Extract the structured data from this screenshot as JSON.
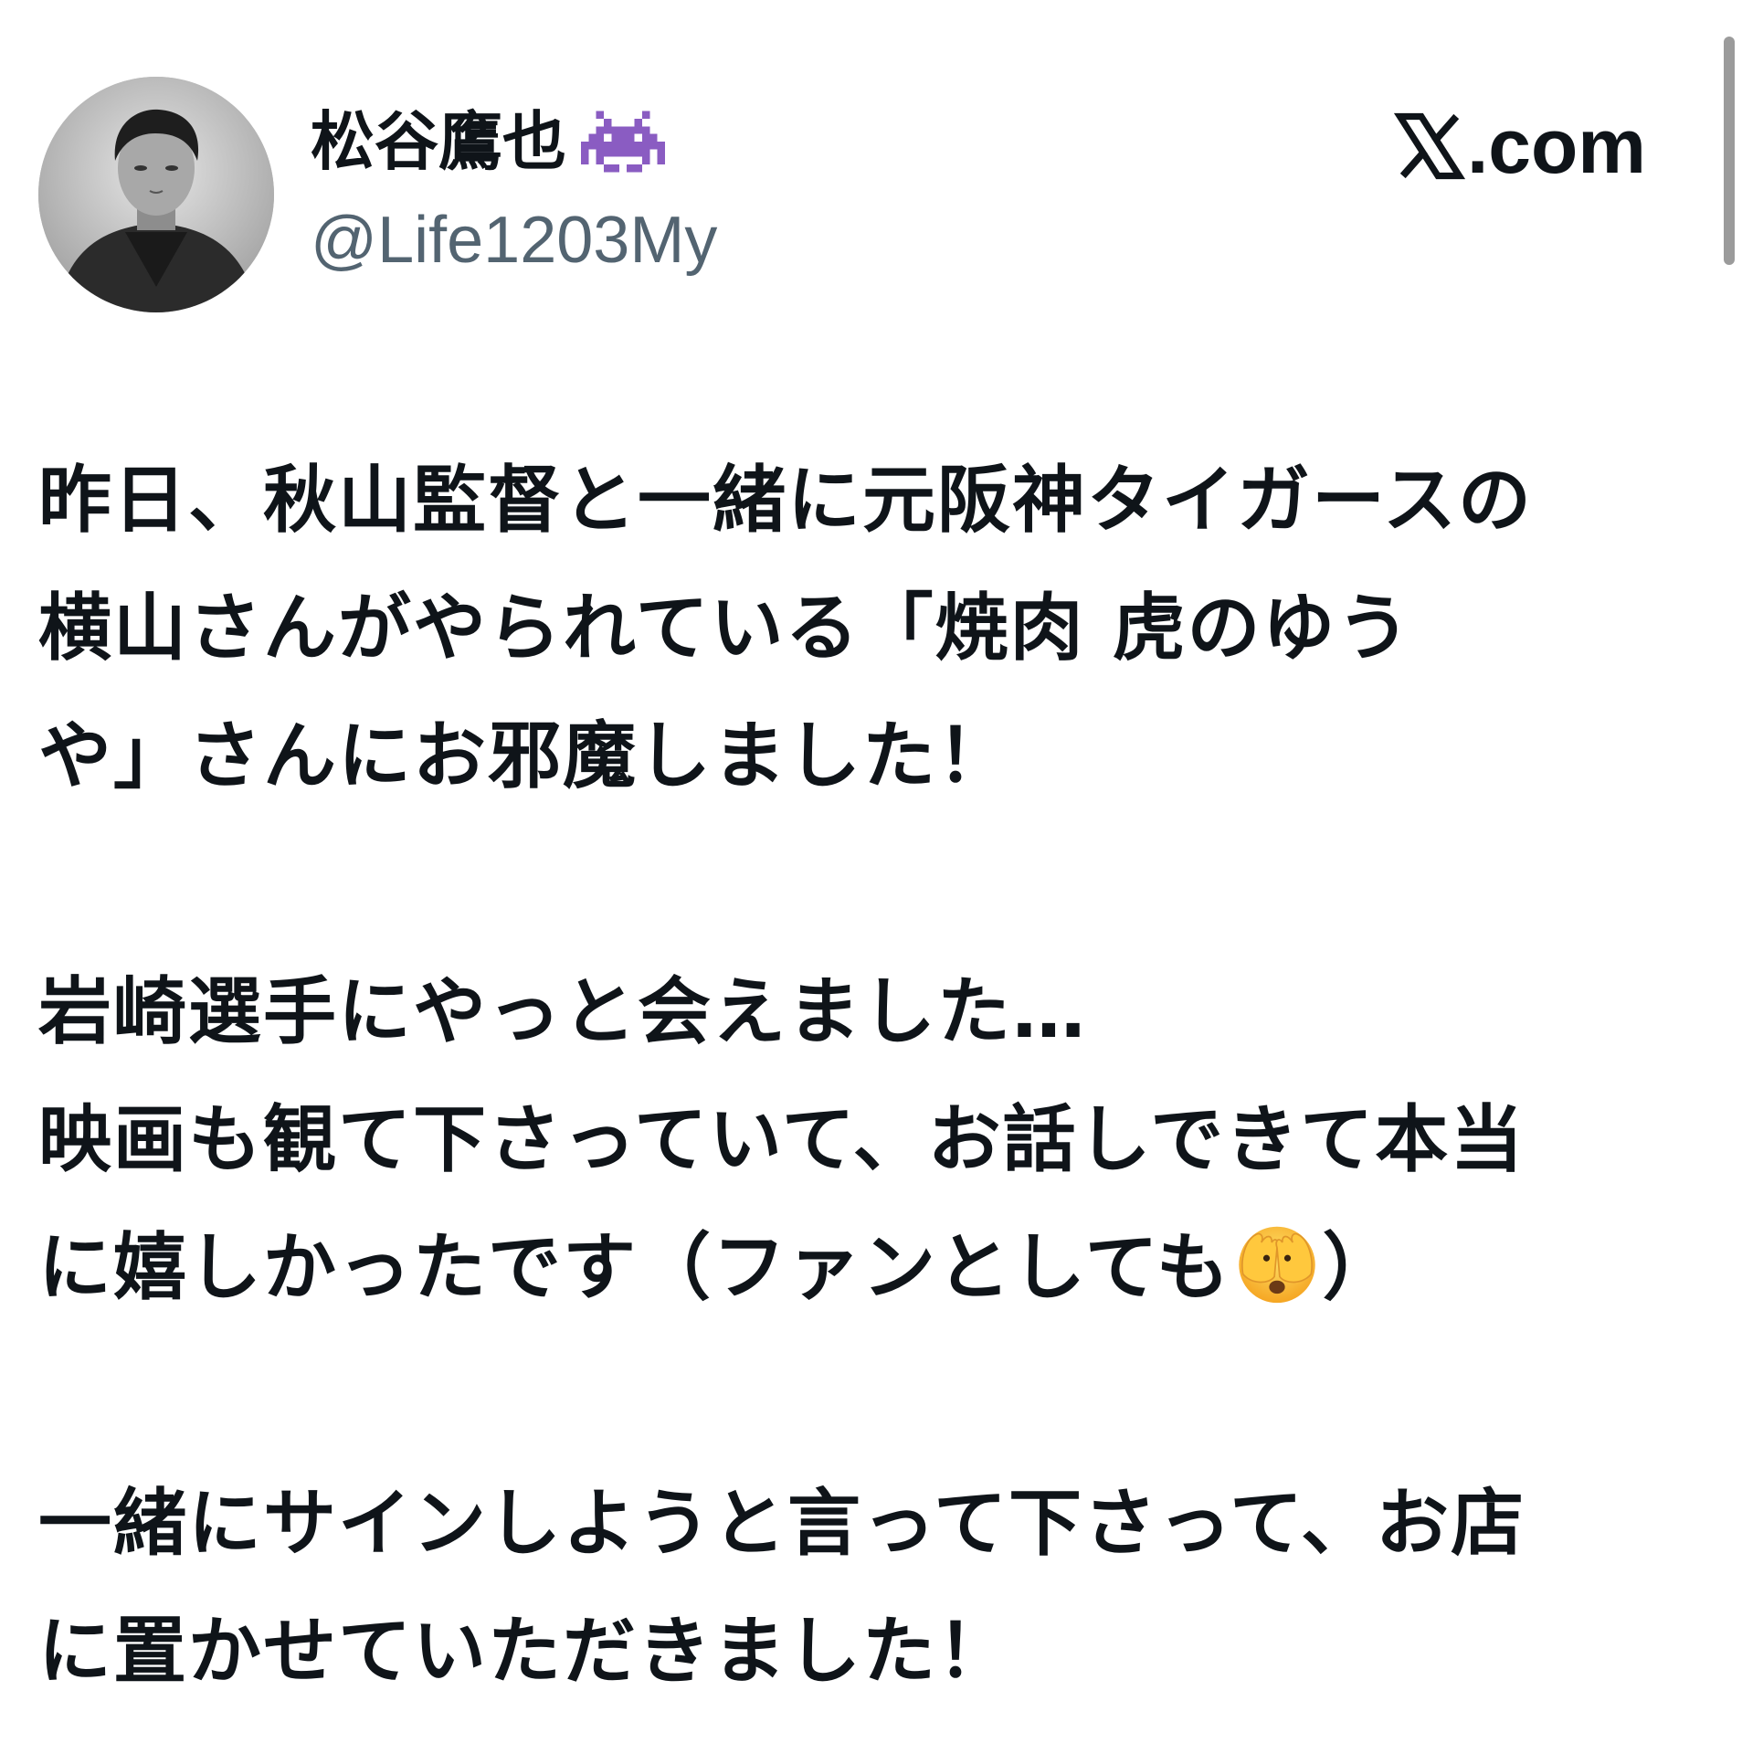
{
  "header": {
    "display_name": "松谷鷹也",
    "name_icon": "alien-monster-icon",
    "handle": "@Life1203My",
    "brand_text": ".com",
    "brand_icon": "x-logo-icon"
  },
  "tweet": {
    "para1": {
      "line1": "昨日、秋山監督と一緒に元阪神タイガースの",
      "line2": "横山さんがやられている「焼肉 虎のゆう",
      "line3": "や」さんにお邪魔しました！"
    },
    "para2": {
      "line1": "岩崎選手にやっと会えました…",
      "line2": "映画も観て下さっていて、お話しできて本当",
      "line3_before": "に嬉しかったです（ファンとしても",
      "line3_emoji": "face-with-hands-over-eyes-icon",
      "line3_after": "）"
    },
    "para3": {
      "line1": "一緒にサインしようと言って下さって、お店",
      "line2": "に置かせていただきました！"
    }
  },
  "colors": {
    "text": "#0f1419",
    "handle": "#536471",
    "icon_purple": "#8a5cc2",
    "background": "#ffffff"
  }
}
